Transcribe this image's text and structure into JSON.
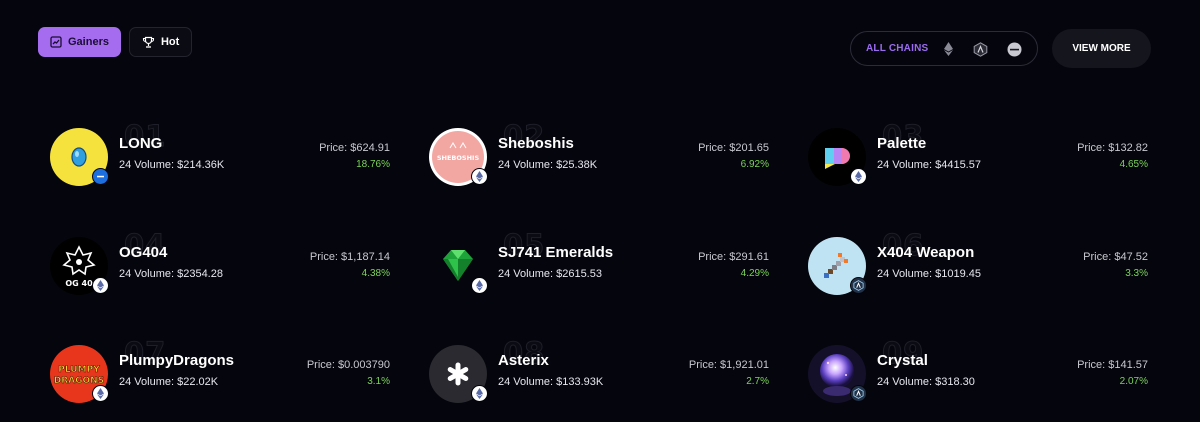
{
  "tabs": [
    {
      "label": "Gainers",
      "icon": "trending-chart-icon",
      "active": true
    },
    {
      "label": "Hot",
      "icon": "trophy-icon",
      "active": false
    }
  ],
  "chains": {
    "all_label": "ALL CHAINS",
    "icons": [
      "ethereum-icon",
      "arbitrum-icon",
      "base-icon"
    ]
  },
  "view_more_label": "VIEW MORE",
  "colors": {
    "accent": "#a56cf0",
    "positive": "#7bd45a",
    "background": "#05050d"
  },
  "collections": [
    {
      "rank": "01",
      "name": "LONG",
      "volume": "24 Volume: $214.36K",
      "price": "Price: $624.91",
      "change": "18.76%",
      "chain": "base-icon",
      "avatar": "blue-egg-icon"
    },
    {
      "rank": "02",
      "name": "Sheboshis",
      "volume": "24 Volume: $25.38K",
      "price": "Price: $201.65",
      "change": "6.92%",
      "chain": "ethereum-icon",
      "avatar": "sheboshis-logo"
    },
    {
      "rank": "03",
      "name": "Palette",
      "volume": "24 Volume: $4415.57",
      "price": "Price: $132.82",
      "change": "4.65%",
      "chain": "ethereum-icon",
      "avatar": "palette-logo"
    },
    {
      "rank": "04",
      "name": "OG404",
      "volume": "24 Volume: $2354.28",
      "price": "Price: $1,187.14",
      "change": "4.38%",
      "chain": "ethereum-icon",
      "avatar": "og404-logo"
    },
    {
      "rank": "05",
      "name": "SJ741 Emeralds",
      "volume": "24 Volume: $2615.53",
      "price": "Price: $291.61",
      "change": "4.29%",
      "chain": "ethereum-icon",
      "avatar": "emerald-gem-icon"
    },
    {
      "rank": "06",
      "name": "X404 Weapon",
      "volume": "24 Volume: $1019.45",
      "price": "Price: $47.52",
      "change": "3.3%",
      "chain": "arbitrum-icon",
      "avatar": "pixel-weapon-icon"
    },
    {
      "rank": "07",
      "name": "PlumpyDragons",
      "volume": "24 Volume: $22.02K",
      "price": "Price: $0.003790",
      "change": "3.1%",
      "chain": "ethereum-icon",
      "avatar": "plumpy-dragons-logo",
      "avatar_text": [
        "PLUMPY",
        "DRAGONS"
      ]
    },
    {
      "rank": "08",
      "name": "Asterix",
      "volume": "24 Volume: $133.93K",
      "price": "Price: $1,921.01",
      "change": "2.7%",
      "chain": "ethereum-icon",
      "avatar": "asterisk-logo"
    },
    {
      "rank": "09",
      "name": "Crystal",
      "volume": "24 Volume: $318.30",
      "price": "Price: $141.57",
      "change": "2.07%",
      "chain": "arbitrum-icon",
      "avatar": "crystal-ball-icon"
    }
  ]
}
